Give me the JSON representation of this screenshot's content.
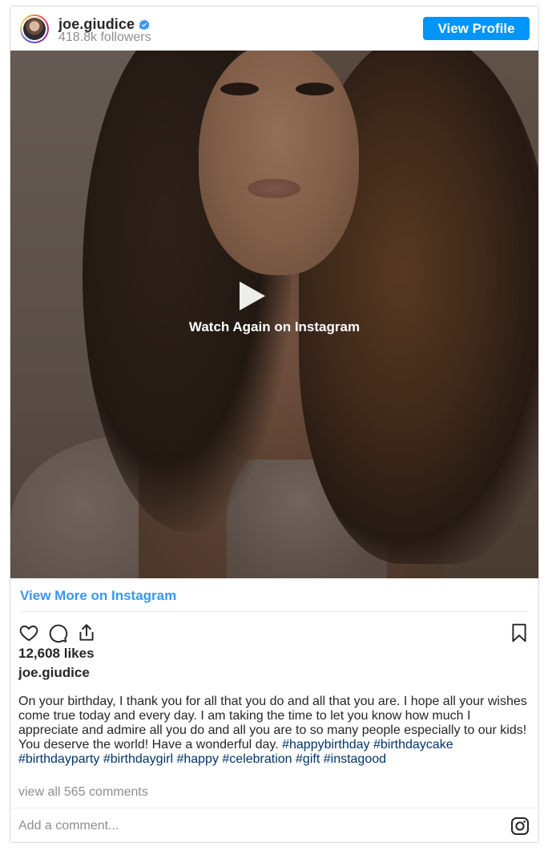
{
  "header": {
    "username": "joe.giudice",
    "followers": "418.8k followers",
    "view_profile_label": "View Profile",
    "verified": true
  },
  "media": {
    "overlay_text": "Watch Again on Instagram"
  },
  "view_more_label": "View More on Instagram",
  "actions": {
    "icons": [
      "heart-icon",
      "comment-icon",
      "share-icon",
      "bookmark-icon"
    ]
  },
  "likes": "12,608 likes",
  "caption": {
    "username": "joe.giudice",
    "text": "On your birthday, I thank you for all that you do and all that you are. I hope all your wishes come true today and every day. I am taking the time to let you know how much I appreciate and admire all you do and all you are to so many people especially to our kids! You deserve the world! Have a wonderful day.",
    "hashtags": [
      "#happybirthday",
      "#birthdaycake",
      "#birthdayparty",
      "#birthdaygirl",
      "#happy",
      "#celebration",
      "#gift",
      "#instagood"
    ]
  },
  "view_all_comments": "view all 565 comments",
  "comment_placeholder": "Add a comment...",
  "colors": {
    "button_blue": "#0095f6",
    "link_blue": "#3897f0",
    "hashtag_blue": "#003569",
    "muted_gray": "#8e8e8e"
  }
}
